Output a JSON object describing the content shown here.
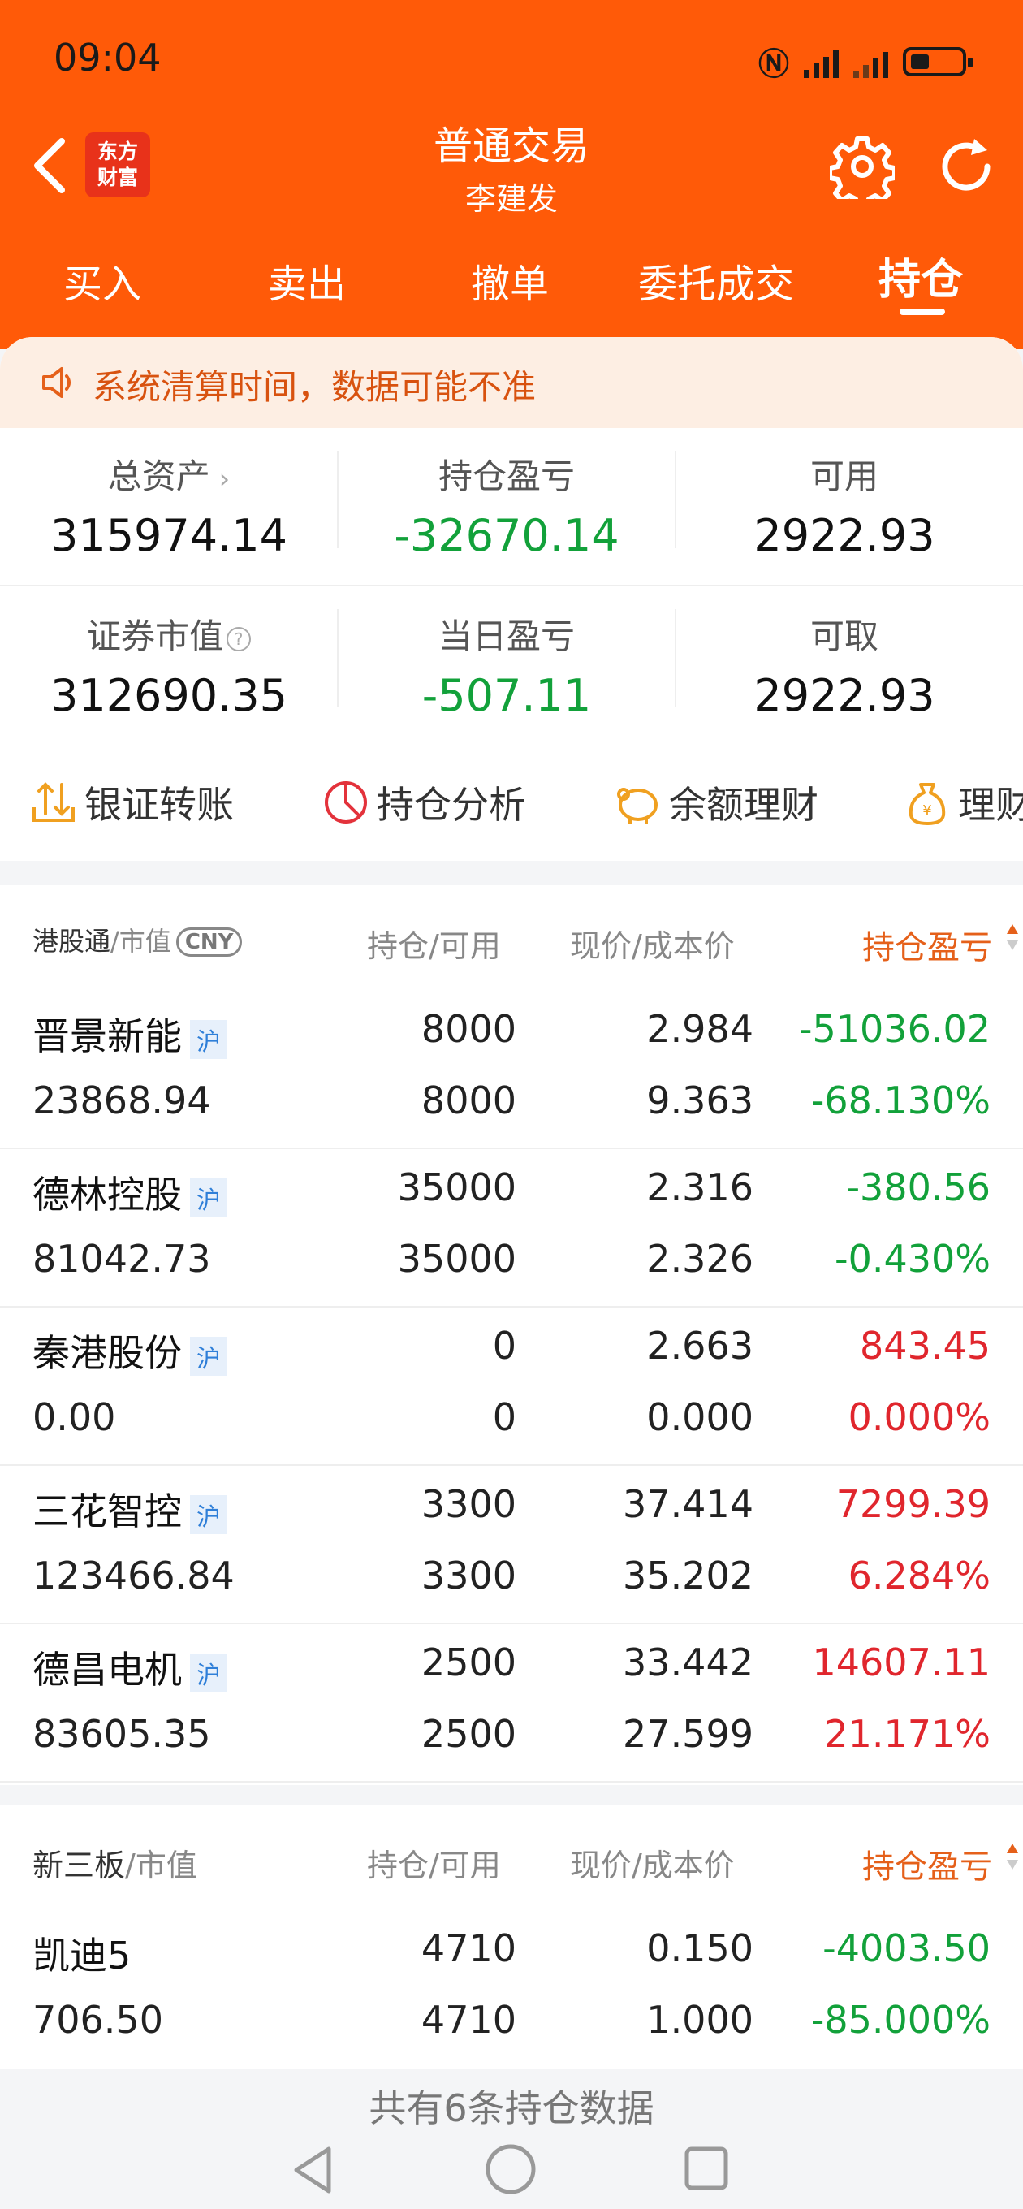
{
  "status": {
    "time": "09:04"
  },
  "header": {
    "logo_line1": "东方",
    "logo_line2": "财富",
    "title": "普通交易",
    "subtitle": "李建发"
  },
  "tabs": [
    {
      "label": "买入"
    },
    {
      "label": "卖出"
    },
    {
      "label": "撤单"
    },
    {
      "label": "委托成交"
    },
    {
      "label": "持仓"
    }
  ],
  "notice": {
    "text": "系统清算时间，数据可能不准"
  },
  "summary": {
    "total_assets_label": "总资产",
    "total_assets": "315974.14",
    "position_pnl_label": "持仓盈亏",
    "position_pnl": "-32670.14",
    "available_label": "可用",
    "available": "2922.93",
    "market_value_label": "证券市值",
    "market_value": "312690.35",
    "daily_pnl_label": "当日盈亏",
    "daily_pnl": "-507.11",
    "withdrawable_label": "可取",
    "withdrawable": "2922.93"
  },
  "tools": [
    {
      "label": "银证转账"
    },
    {
      "label": "持仓分析"
    },
    {
      "label": "余额理财"
    },
    {
      "label": "理财"
    }
  ],
  "hk_section": {
    "title": "港股通",
    "title_suffix": "/市值",
    "currency": "CNY",
    "col_position": "持仓/可用",
    "col_price": "现价/成本价",
    "col_pnl": "持仓盈亏",
    "rows": [
      {
        "name": "晋景新能",
        "market": "沪",
        "market_value": "23868.94",
        "position": "8000",
        "available": "8000",
        "price": "2.984",
        "cost": "9.363",
        "pnl": "-51036.02",
        "pnl_pct": "-68.130%",
        "sign": "neg"
      },
      {
        "name": "德林控股",
        "market": "沪",
        "market_value": "81042.73",
        "position": "35000",
        "available": "35000",
        "price": "2.316",
        "cost": "2.326",
        "pnl": "-380.56",
        "pnl_pct": "-0.430%",
        "sign": "neg"
      },
      {
        "name": "秦港股份",
        "market": "沪",
        "market_value": "0.00",
        "position": "0",
        "available": "0",
        "price": "2.663",
        "cost": "0.000",
        "pnl": "843.45",
        "pnl_pct": "0.000%",
        "sign": "pos"
      },
      {
        "name": "三花智控",
        "market": "沪",
        "market_value": "123466.84",
        "position": "3300",
        "available": "3300",
        "price": "37.414",
        "cost": "35.202",
        "pnl": "7299.39",
        "pnl_pct": "6.284%",
        "sign": "pos"
      },
      {
        "name": "德昌电机",
        "market": "沪",
        "market_value": "83605.35",
        "position": "2500",
        "available": "2500",
        "price": "33.442",
        "cost": "27.599",
        "pnl": "14607.11",
        "pnl_pct": "21.171%",
        "sign": "pos"
      }
    ]
  },
  "neeq_section": {
    "title": "新三板",
    "title_suffix": "/市值",
    "col_position": "持仓/可用",
    "col_price": "现价/成本价",
    "col_pnl": "持仓盈亏",
    "rows": [
      {
        "name": "凯迪5",
        "market_value": "706.50",
        "position": "4710",
        "available": "4710",
        "price": "0.150",
        "cost": "1.000",
        "pnl": "-4003.50",
        "pnl_pct": "-85.000%",
        "sign": "neg"
      }
    ]
  },
  "footer": {
    "text": "共有6条持仓数据"
  },
  "colors": {
    "brand": "#ff5a08",
    "loss": "#12a13a",
    "gain": "#e0262d",
    "accent_text": "#e5601a"
  }
}
